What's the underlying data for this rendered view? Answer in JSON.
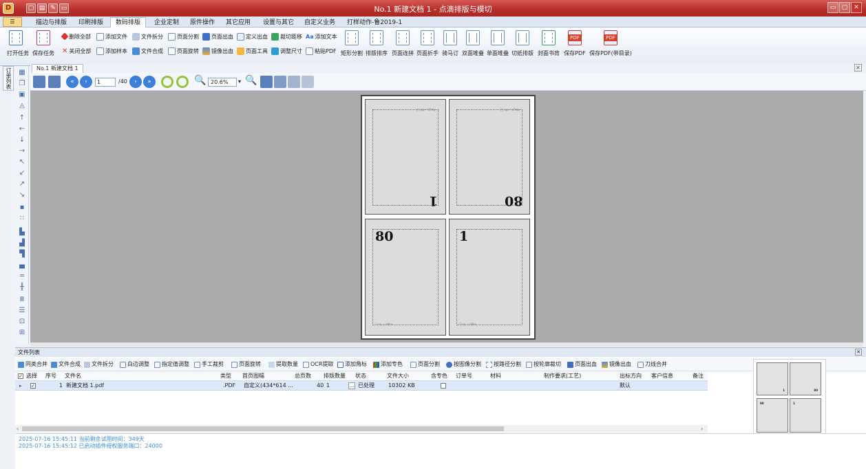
{
  "window": {
    "title": "No.1 新建文档 1 - 点滴排版与模切",
    "controls": [
      "▭",
      "▢",
      "✕"
    ]
  },
  "tabs": {
    "menu_label": "☰",
    "items": [
      "描边与排版",
      "印刷排版",
      "数码排版",
      "企业定制",
      "原件操作",
      "其它应用",
      "设置与其它",
      "自定义业务",
      "打样动作-鲁2019-1"
    ],
    "active_index": 2
  },
  "ribbon": {
    "open_task": "打开任务",
    "save_task": "保存任务",
    "delete_all": "删除全部",
    "close_all": "关闭全部",
    "add_file": "添加文件",
    "add_sample": "添加样本",
    "file_split": "文件拆分",
    "file_merge": "文件合成",
    "page_split": "页面分割",
    "page_rotate": "页面旋转",
    "page_bleed": "页面出血",
    "mirror_bleed": "镜像出血",
    "define_bleed": "定义出血",
    "page_tool": "页面工具",
    "crop_offset": "裁切距移",
    "adjust_size": "调整尺寸",
    "add_text": "添加文本",
    "paste_pdf": "粘贴PDF",
    "big_buttons": [
      "矩形分割",
      "排版排序",
      "页面连拼",
      "页面折手",
      "骑马订",
      "双面堆叠",
      "单面堆叠",
      "切纸排版",
      "封面书背",
      "保存PDF",
      "保存PDF(带目录)"
    ]
  },
  "left_panel": {
    "vertical_tab": "订单列表"
  },
  "document": {
    "tab_label": "No.1 新建文档 1",
    "current_page": "1",
    "total_pages": "/40",
    "zoom": "20.6%",
    "sheet": {
      "cells": [
        {
          "number": "1",
          "rotated": true,
          "tiny_top": "Magz = Mh12",
          "tiny_bottom": ""
        },
        {
          "number": "80",
          "rotated": true,
          "tiny_top": "Magz = Mh12",
          "tiny_bottom": ""
        },
        {
          "number": "80",
          "rotated": false,
          "tiny_top": "",
          "tiny_bottom": "Crop = 0Mm"
        },
        {
          "number": "1",
          "rotated": false,
          "tiny_top": "",
          "tiny_bottom": "Crop = 0Mm"
        }
      ]
    }
  },
  "file_list": {
    "panel_title": "文件列表",
    "toolbar": [
      "同类合并",
      "文件合成",
      "文件拆分",
      "白边调整",
      "指定值调整",
      "手工裁剪",
      "页面旋转",
      "提取数量",
      "OCR提取",
      "添加角标",
      "添加专色",
      "页面分割",
      "按图像分割",
      "按路径分割",
      "按轮廓裁切",
      "页面出血",
      "镜像出血",
      "刀线合并"
    ],
    "columns": [
      "选择",
      "序号",
      "文件名",
      "类型",
      "首页图幅",
      "总页数",
      "排版数量",
      "状态",
      "文件大小",
      "含专色",
      "订单号",
      "材料",
      "制作要求(工艺)",
      "出标方向",
      "客户信息",
      "备注"
    ],
    "rows": [
      {
        "selected": true,
        "index": "1",
        "filename": "新建文档 1.pdf",
        "type": ".PDF",
        "first_page_size": "自定义(434*614 ...",
        "total_pages": "40",
        "layout_qty": "1",
        "status": "已处理",
        "file_size": "10302 KB",
        "spot_color": false,
        "order_no": "",
        "material": "",
        "requirements": "",
        "label_direction": "默认",
        "customer": "",
        "remark": ""
      }
    ]
  },
  "thumbnail": {
    "numbers": [
      "1",
      "80",
      "80",
      "1"
    ]
  },
  "log": [
    "2025-07-16 15:45:11 当前剩余试用时间：349天",
    "2025-07-16 15:45:12 已启动插件授权服务端口：24000"
  ]
}
